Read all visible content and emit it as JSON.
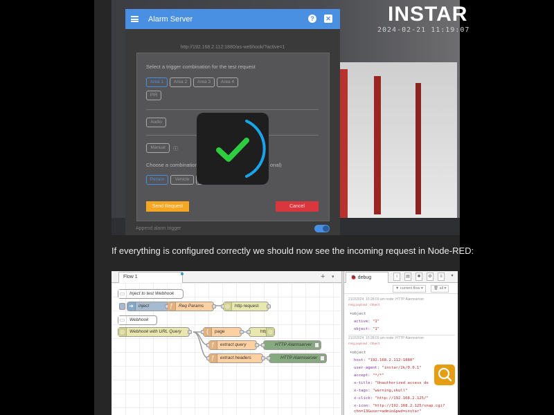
{
  "screenshot": {
    "logo_text": "INSTAR",
    "timestamp": "2024-02-21 11:19:07",
    "panel_title": "Alarm Server",
    "url": "http://192.168.2.112:1880/as-webhook/?active=1",
    "prompt1": "Select a trigger combination for the test request",
    "areas": [
      "Area 1",
      "Area 2",
      "Area 3",
      "Area 4"
    ],
    "pir": "PIR",
    "audio": "Audio",
    "manual": "Manual",
    "prompt2": "Choose a combination of",
    "prompt2_tail": "onal)",
    "objects": [
      "Person",
      "Vehicle",
      ""
    ],
    "send_label": "Send Request",
    "cancel_label": "Cancel",
    "toggle_label": "Append alarm trigger",
    "colors": {
      "primary": "#4a90e2",
      "send": "#f5a623",
      "cancel": "#d9363e",
      "success": "#2ecc40"
    }
  },
  "caption": "If everything is configured correctly we should now see the incoming request in Node-RED:",
  "nodered": {
    "flow_tab": "Flow 1",
    "nodes": {
      "comment1": "Inject to test Webhook",
      "inject": "inject",
      "req_params": "Req Params",
      "http_request": "http request",
      "comment2": "Webhook",
      "webhook_url": "Webhook with URL Query",
      "page": "page",
      "http": "http",
      "extract_query": "extract query",
      "alarmserver1": "HTTP Alarmserver",
      "extract_headers": "extract headers",
      "alarmserver2": "HTTP Alarmserver"
    },
    "sidebar": {
      "tab": "debug",
      "filter": "current flow",
      "clear": "all",
      "messages": [
        {
          "meta": "21/2/2024, 10:28:03 am    node: HTTP Alarmserver",
          "topic": "msg.payload : Object",
          "lines": [
            {
              "t": "▾object",
              "cls": ""
            },
            {
              "t": "active: \"1\"",
              "cls": "kv"
            },
            {
              "t": "object: \"1\"",
              "cls": "kv"
            }
          ]
        },
        {
          "meta": "21/2/2024, 10:28:03 am    node: HTTP Alarmserver",
          "topic": "msg.payload : Object",
          "lines": [
            {
              "t": "▾object",
              "cls": ""
            },
            {
              "t": "host: \"192.168.2.112:1880\"",
              "cls": "kv"
            },
            {
              "t": "user-agent: \"instar/2k/0.0.1\"",
              "cls": "kv"
            },
            {
              "t": "accept: \"*/*\"",
              "cls": "kv"
            },
            {
              "t": "x-title: \"Unauthorized access de",
              "cls": "kv"
            },
            {
              "t": "x-tags: \"warning,skull\"",
              "cls": "kv"
            },
            {
              "t": "x-click: \"http://192.168.2.125/\"",
              "cls": "kv"
            },
            {
              "t": "x-icon: \"http://192.168.2.125/snap.cgi?",
              "cls": "kv"
            },
            {
              "t": "chn=13&user=admin&pwd=instar\"",
              "cls": "kv"
            }
          ]
        }
      ]
    }
  }
}
